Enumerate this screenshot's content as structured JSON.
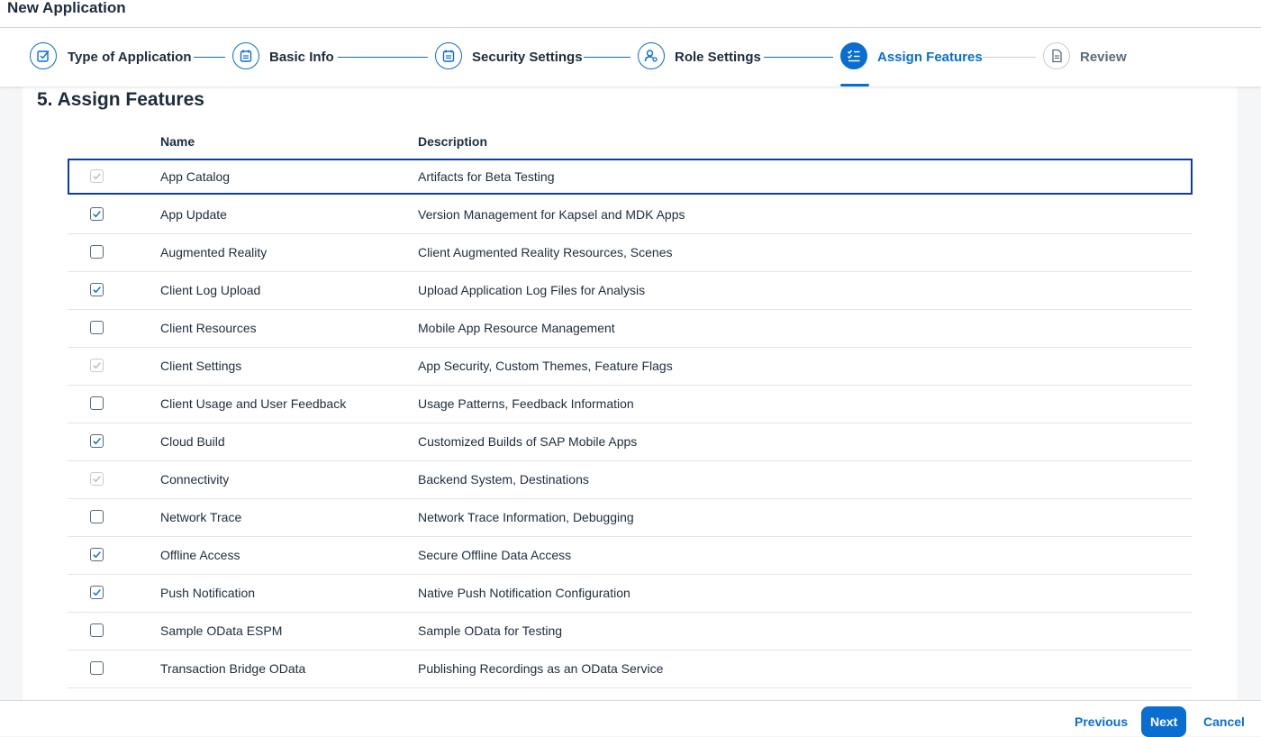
{
  "app": {
    "title": "New Application"
  },
  "wizard": {
    "steps": [
      {
        "label": "Type of Application",
        "state": "done"
      },
      {
        "label": "Basic Info",
        "state": "done"
      },
      {
        "label": "Security Settings",
        "state": "done"
      },
      {
        "label": "Role Settings",
        "state": "done"
      },
      {
        "label": "Assign Features",
        "state": "active"
      },
      {
        "label": "Review",
        "state": "inactive"
      }
    ]
  },
  "section": {
    "title": "5. Assign Features"
  },
  "table": {
    "columns": {
      "name": "Name",
      "description": "Description"
    },
    "rows": [
      {
        "name": "App Catalog",
        "description": "Artifacts for Beta Testing",
        "checked": true,
        "disabled": true
      },
      {
        "name": "App Update",
        "description": "Version Management for Kapsel and MDK Apps",
        "checked": true,
        "disabled": false
      },
      {
        "name": "Augmented Reality",
        "description": "Client Augmented Reality Resources, Scenes",
        "checked": false,
        "disabled": false
      },
      {
        "name": "Client Log Upload",
        "description": "Upload Application Log Files for Analysis",
        "checked": true,
        "disabled": false
      },
      {
        "name": "Client Resources",
        "description": "Mobile App Resource Management",
        "checked": false,
        "disabled": false
      },
      {
        "name": "Client Settings",
        "description": "App Security, Custom Themes, Feature Flags",
        "checked": true,
        "disabled": true
      },
      {
        "name": "Client Usage and User Feedback",
        "description": "Usage Patterns, Feedback Information",
        "checked": false,
        "disabled": false
      },
      {
        "name": "Cloud Build",
        "description": "Customized Builds of SAP Mobile Apps",
        "checked": true,
        "disabled": false
      },
      {
        "name": "Connectivity",
        "description": "Backend System, Destinations",
        "checked": true,
        "disabled": true
      },
      {
        "name": "Network Trace",
        "description": "Network Trace Information, Debugging",
        "checked": false,
        "disabled": false
      },
      {
        "name": "Offline Access",
        "description": "Secure Offline Data Access",
        "checked": true,
        "disabled": false
      },
      {
        "name": "Push Notification",
        "description": "Native Push Notification Configuration",
        "checked": true,
        "disabled": false
      },
      {
        "name": "Sample OData ESPM",
        "description": "Sample OData for Testing",
        "checked": false,
        "disabled": false
      },
      {
        "name": "Transaction Bridge OData",
        "description": "Publishing Recordings as an OData Service",
        "checked": false,
        "disabled": false
      }
    ]
  },
  "footer": {
    "previous": "Previous",
    "next": "Next",
    "cancel": "Cancel"
  },
  "colors": {
    "accent": "#0a6ed1",
    "focus": "#0a3d9e",
    "text": "#1d2d3e"
  }
}
